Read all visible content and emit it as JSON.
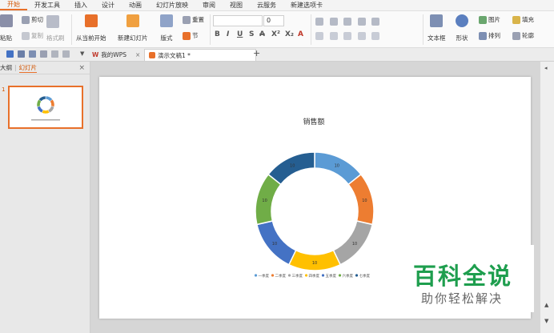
{
  "menu": {
    "tabs": [
      "开始",
      "开发工具",
      "插入",
      "设计",
      "动画",
      "幻灯片放映",
      "审阅",
      "视图",
      "云服务",
      "新建选项卡"
    ],
    "active_index": 0
  },
  "ribbon": {
    "paste": "粘贴",
    "cut": "剪切",
    "copy": "复制",
    "format_painter": "格式刷",
    "from_current": "从当前开始",
    "new_slide": "新建幻灯片",
    "layout": "版式",
    "section": "节",
    "reset": "重置",
    "font_size": "0",
    "textbox": "文本框",
    "shape": "形状",
    "picture": "图片",
    "fill": "填充",
    "arrange": "排列",
    "outline": "轮廓"
  },
  "tabs": {
    "wps_tab": "我的WPS",
    "doc_tab": "演示文稿1 *",
    "new_tab": "+"
  },
  "left_pane": {
    "outline_tab": "大纲",
    "slides_tab": "幻灯片",
    "slide_number": "1"
  },
  "chart_data": {
    "type": "pie",
    "title": "销售额",
    "categories": [
      "一季度",
      "二季度",
      "三季度",
      "四季度",
      "五季度",
      "六季度",
      "七季度"
    ],
    "values": [
      10,
      10,
      10,
      10,
      10,
      10,
      10
    ],
    "colors": [
      "#5b9bd5",
      "#ed7d31",
      "#a5a5a5",
      "#ffc000",
      "#4472c4",
      "#70ad47",
      "#255e91"
    ]
  },
  "watermark": {
    "title": "百科全说",
    "subtitle": "助你轻松解决"
  }
}
